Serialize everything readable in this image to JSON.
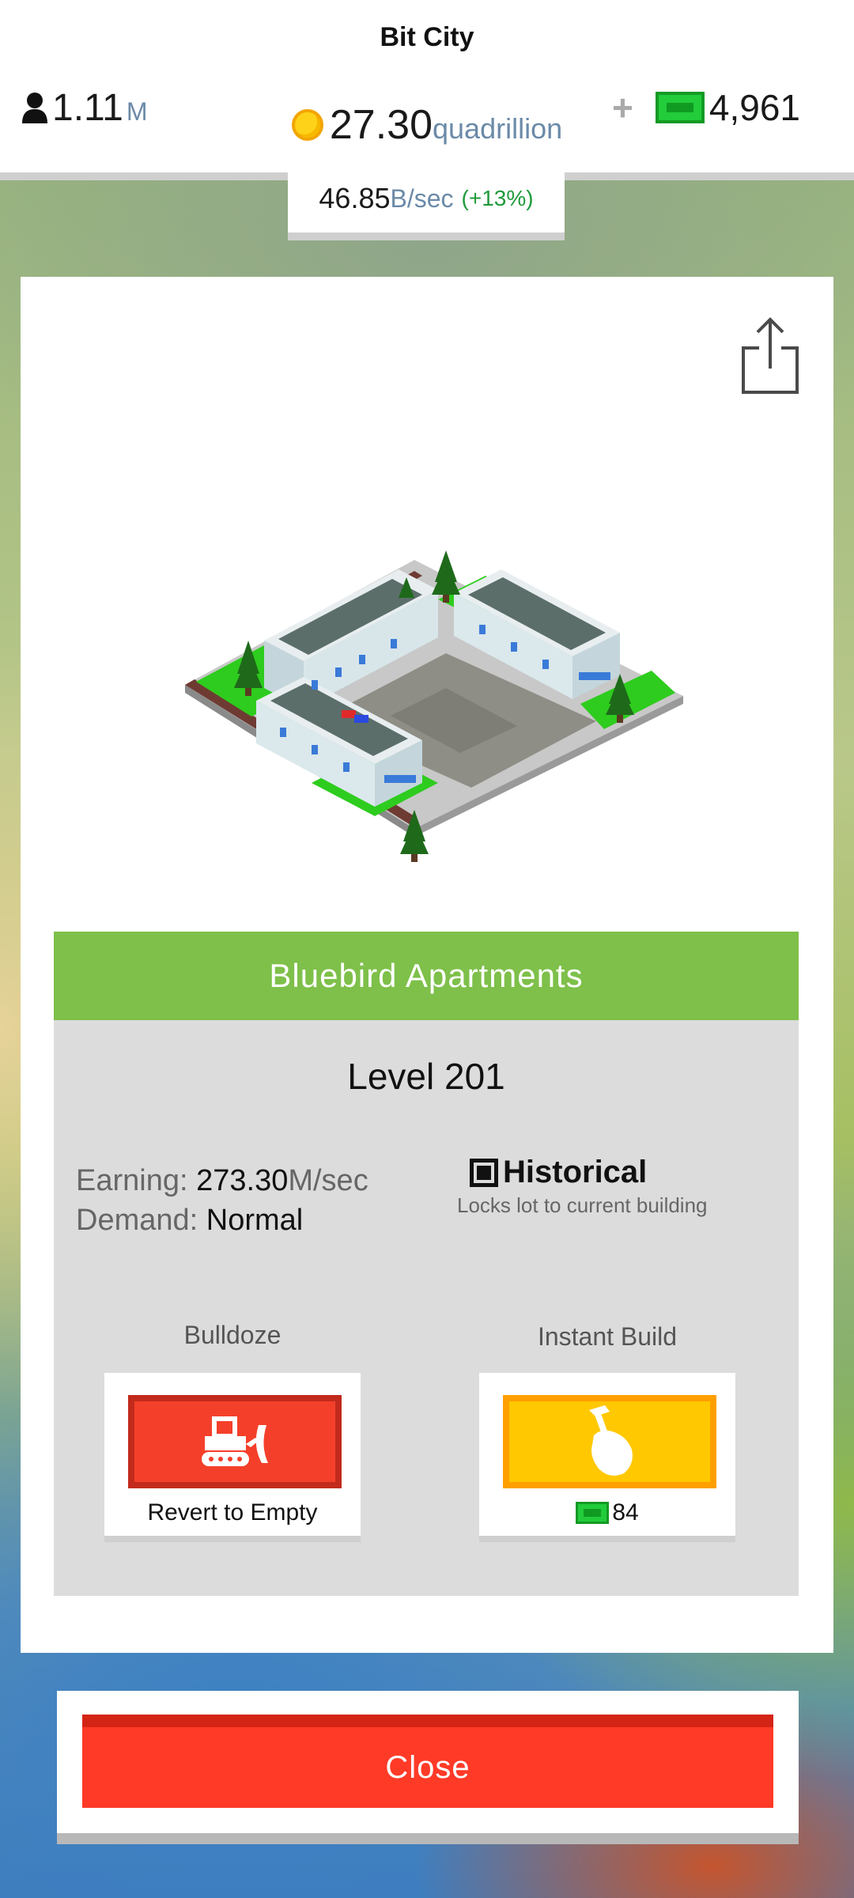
{
  "header": {
    "city_name": "Bit City",
    "population": {
      "value": "1.11",
      "unit": "M",
      "icon": "person-icon"
    },
    "money": {
      "value": "27.30",
      "unit": "quadrillion",
      "icon": "coin-icon"
    },
    "cash": {
      "plus": "+",
      "value": "4,961",
      "icon": "cash-bill-icon"
    },
    "rate": {
      "value": "46.85",
      "unit": "B/sec",
      "bonus": "(+13%)"
    }
  },
  "building": {
    "name": "Bluebird Apartments",
    "level": "Level 201",
    "earning_label": "Earning:",
    "earning_value": "273.30",
    "earning_unit": "M/sec",
    "demand_label": "Demand:",
    "demand_value": "Normal",
    "historical_label": "Historical",
    "historical_desc": "Locks lot to current building",
    "historical_checked": true
  },
  "actions": {
    "bulldoze": {
      "label": "Bulldoze",
      "caption": "Revert to Empty",
      "icon": "bulldozer-icon"
    },
    "instant_build": {
      "label": "Instant Build",
      "cost": "84",
      "icon": "hammer-hand-icon"
    }
  },
  "close_label": "Close",
  "colors": {
    "name_bar": "#7ec04a",
    "bulldoze": "#f4402a",
    "instant_build": "#ffc800",
    "close": "#ff3a27",
    "cash_green": "#22cc3a",
    "unit_blue": "#6b8aa8"
  }
}
